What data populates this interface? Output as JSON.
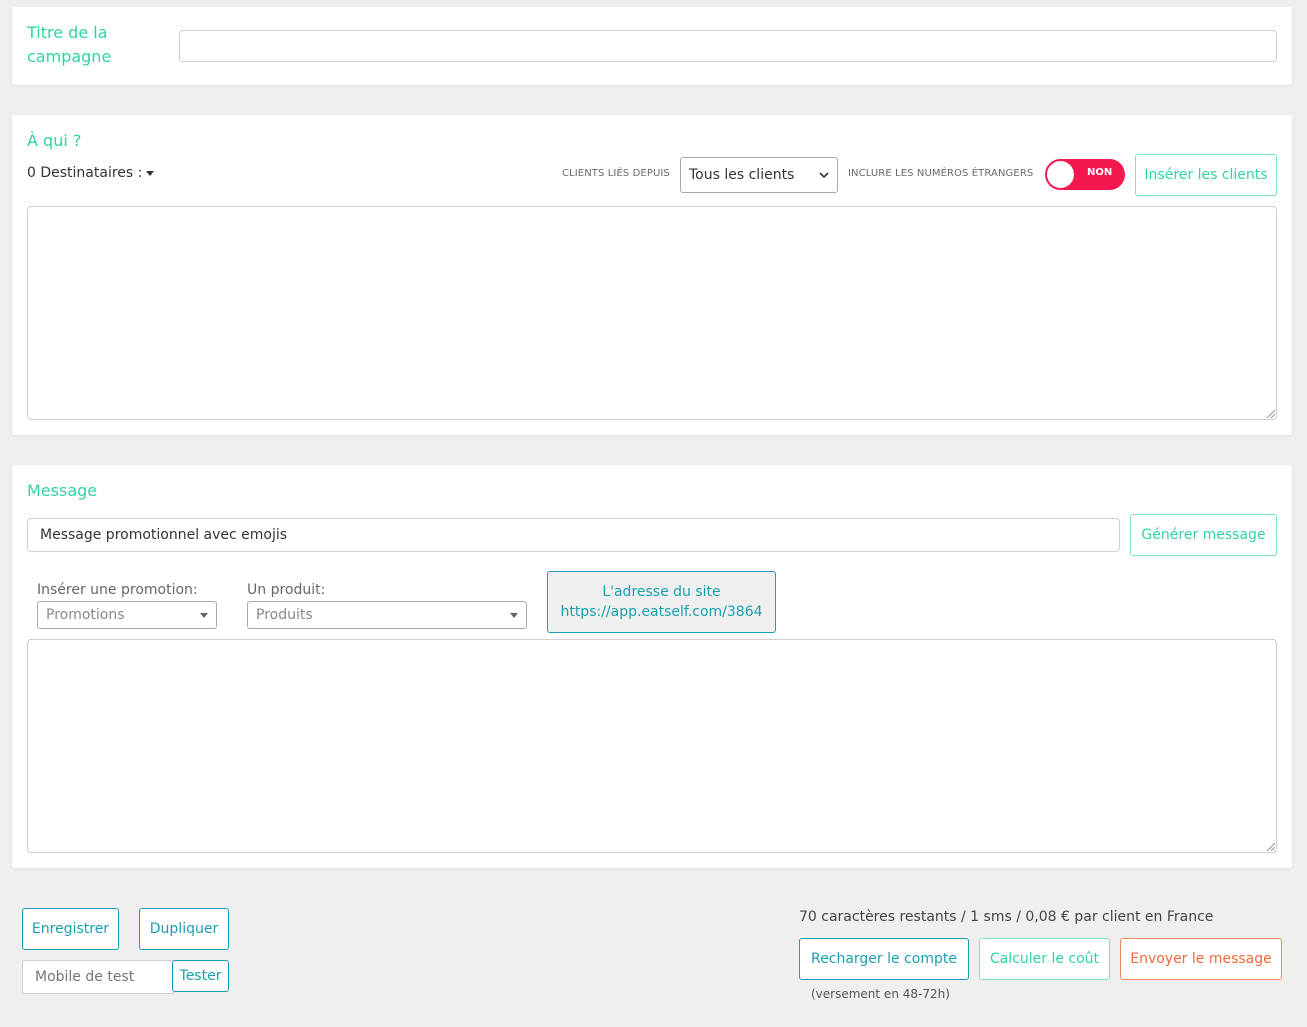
{
  "campaign": {
    "title_label": "Titre de la campagne",
    "title_value": ""
  },
  "recipients": {
    "section_title": "À qui ?",
    "count_label": "0 Destinataires :",
    "clients_since_label": "CLIENTS LIÉS DEPUIS",
    "clients_since_value": "Tous les clients",
    "foreign_numbers_label": "INCLURE LES NUMÉROS ÉTRANGERS",
    "foreign_toggle_label": "NON",
    "insert_clients_button": "Insérer les clients",
    "list_value": ""
  },
  "message": {
    "section_title": "Message",
    "prompt_value": "Message promotionnel avec emojis",
    "generate_button": "Générer message",
    "promotion_label": "Insérer une promotion:",
    "promotion_select": "Promotions",
    "product_label": "Un produit:",
    "product_select": "Produits",
    "site_address_line1": "L'adresse du site",
    "site_address_line2": "https://app.eatself.com/3864",
    "body_value": ""
  },
  "footer": {
    "save_button": "Enregistrer",
    "duplicate_button": "Dupliquer",
    "test_mobile_placeholder": "Mobile de test",
    "test_button": "Tester",
    "stats_text": "70 caractères restants / 1 sms / 0,08 € par client en France",
    "recharge_button": "Recharger le compte",
    "calculate_button": "Calculer le coût",
    "send_button": "Envoyer le message",
    "payment_note": "(versement en 48-72h)"
  },
  "colors": {
    "accent_green": "#2fd4a2",
    "teal": "#1a9fb0",
    "toggle_off": "#f5184f",
    "send_orange": "#ef6a3b"
  }
}
